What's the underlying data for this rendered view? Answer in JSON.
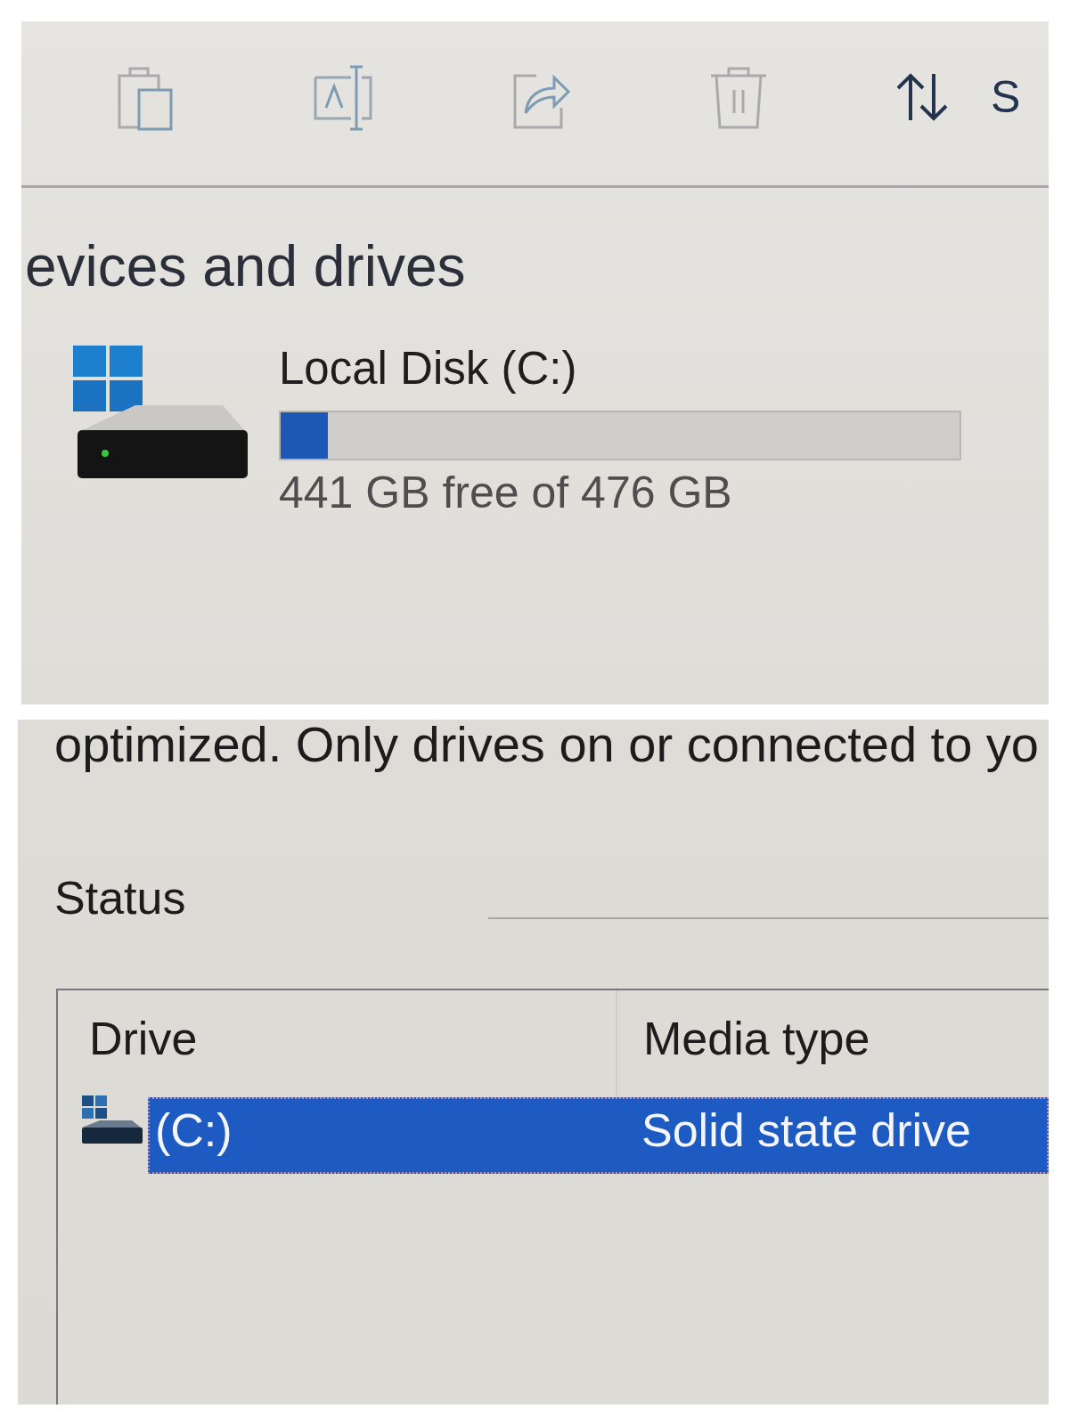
{
  "toolbar": {
    "sort_button": {
      "label": "S"
    }
  },
  "devices_section": {
    "heading": "evices and drives",
    "drives": [
      {
        "name": "Local Disk (C:)",
        "level": 0.07,
        "free_text": "441 GB free of 476 GB"
      }
    ]
  },
  "optimize_panel": {
    "description": "optimized. Only drives on or connected to yo",
    "status_label": "Status",
    "table": {
      "columns": [
        "Drive",
        "Media type"
      ],
      "rows": [
        {
          "cells": [
            "(C:)",
            "Solid state drive"
          ],
          "selected": true
        }
      ]
    }
  }
}
